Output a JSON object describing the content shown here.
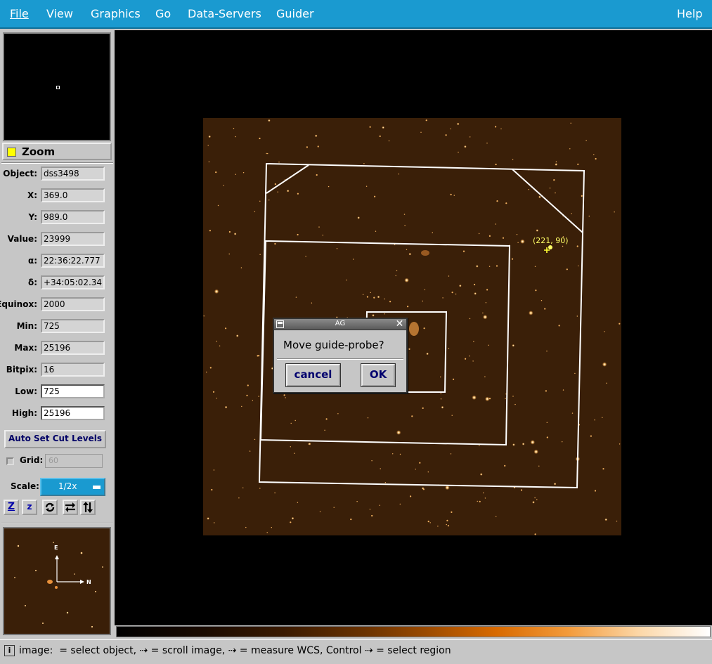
{
  "menubar": {
    "items": [
      "File",
      "View",
      "Graphics",
      "Go",
      "Data-Servers",
      "Guider"
    ],
    "help": "Help"
  },
  "zoom": {
    "label": "Zoom"
  },
  "fields": [
    {
      "label": "Object:",
      "value": "dss3498"
    },
    {
      "label": "X:",
      "value": "369.0"
    },
    {
      "label": "Y:",
      "value": "989.0"
    },
    {
      "label": "Value:",
      "value": "23999"
    },
    {
      "label": "α:",
      "value": "22:36:22.777"
    },
    {
      "label": "δ:",
      "value": "+34:05:02.34"
    },
    {
      "label": "Equinox:",
      "value": "2000"
    },
    {
      "label": "Min:",
      "value": "725"
    },
    {
      "label": "Max:",
      "value": "25196"
    },
    {
      "label": "Bitpix:",
      "value": "16"
    },
    {
      "label": "Low:",
      "value": "725"
    },
    {
      "label": "High:",
      "value": "25196"
    }
  ],
  "autoset": {
    "label": "Auto Set Cut Levels"
  },
  "grid": {
    "label": "Grid:",
    "value": "60"
  },
  "scale": {
    "label": "Scale:",
    "value": "1/2x"
  },
  "toolbar": [
    "Z",
    "z",
    "rotate-icon",
    "flip-horizontal-icon",
    "flip-vertical-icon"
  ],
  "thumbnail": {
    "compass_e": "E",
    "compass_n": "N"
  },
  "image": {
    "marker_label": "(221, 90)",
    "marker_color": "#ffff33"
  },
  "statusbar": {
    "text": "image:  = select object, ⇢ = scroll image, ⇢ = measure WCS, Control ⇢ = select region"
  },
  "dialog": {
    "title": "AG",
    "message": "Move guide-probe?",
    "cancel": "cancel",
    "ok": "OK"
  },
  "colors": {
    "menubar": "#1a9ad0",
    "panel": "#c6c6c6",
    "image_bg": "#3a1f08",
    "button_text": "#00006e"
  }
}
